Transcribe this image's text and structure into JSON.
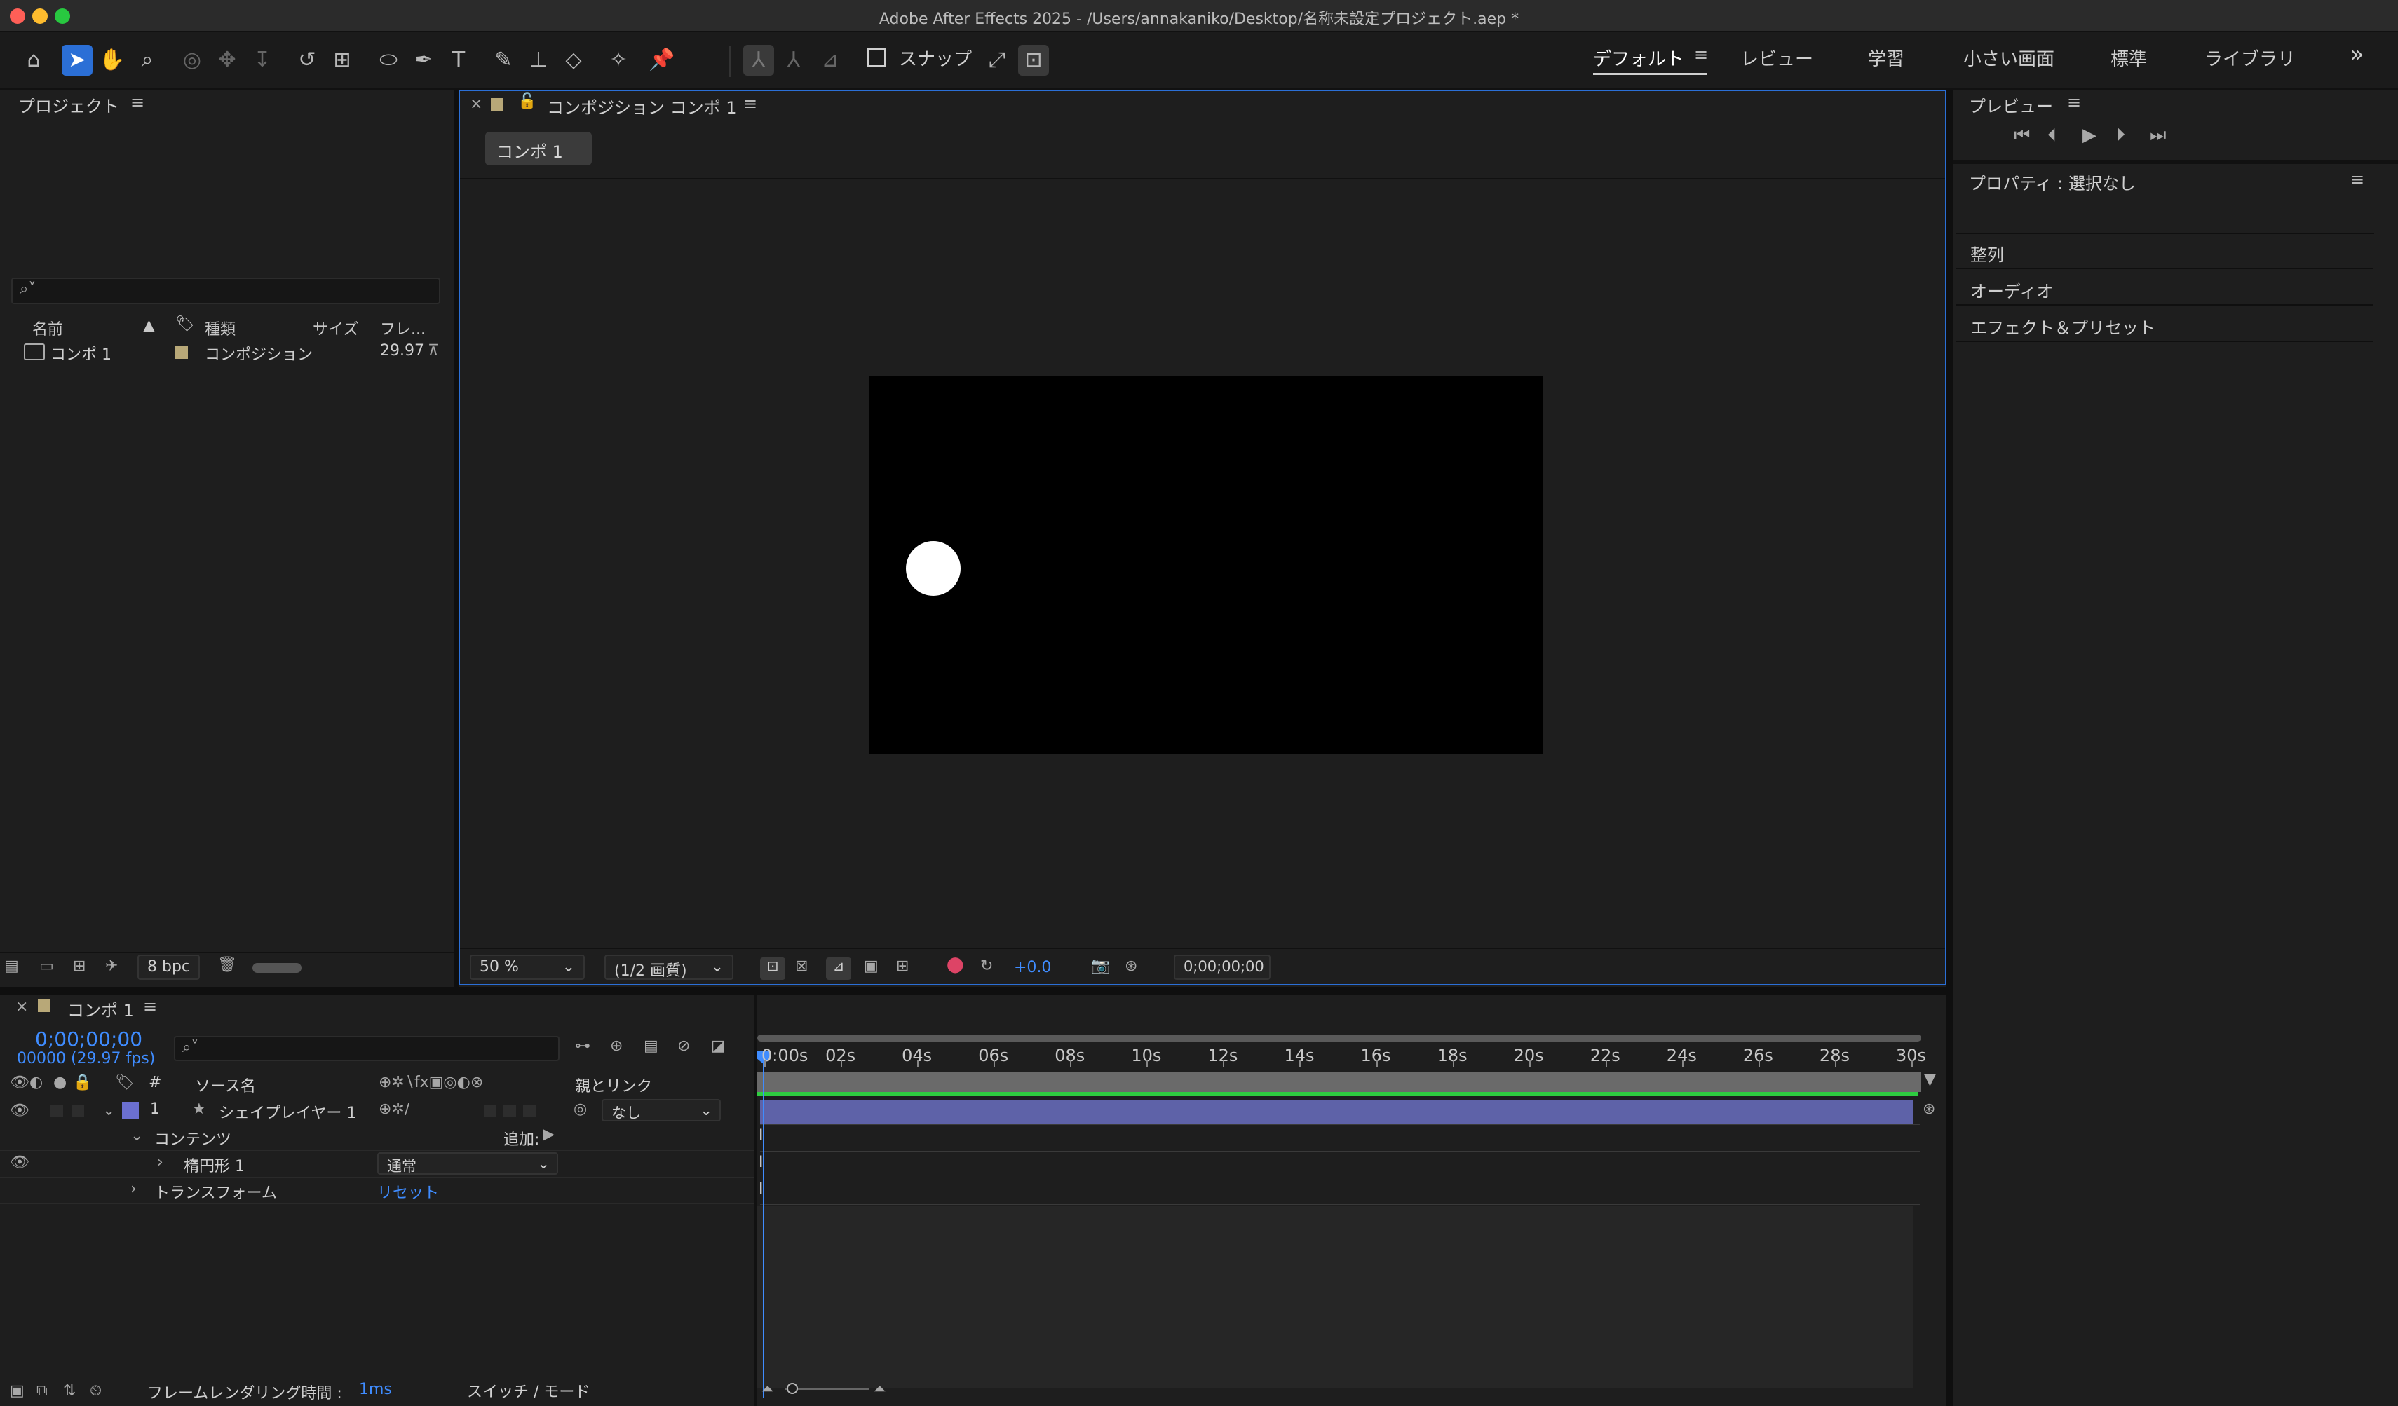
{
  "window": {
    "title": "Adobe After Effects 2025 - /Users/annakaniko/Desktop/名称未設定プロジェクト.aep *"
  },
  "colors": {
    "accent": "#2b6fd6",
    "timecode": "#3f8cff",
    "layer_bar": "#5e62a8",
    "work_area": "#2ecc40",
    "label_tan": "#b8a878"
  },
  "toolbar": {
    "icons": [
      "home-icon",
      "selection-tool-icon",
      "hand-tool-icon",
      "zoom-tool-icon",
      "orbit-camera-icon",
      "pan-camera-icon",
      "dolly-camera-icon",
      "rotation-tool-icon",
      "pan-behind-icon",
      "ellipse-tool-icon",
      "pen-tool-icon",
      "type-tool-icon",
      "brush-tool-icon",
      "clone-stamp-icon",
      "eraser-icon",
      "roto-brush-icon",
      "puppet-pin-icon"
    ],
    "snap_label": "スナップ"
  },
  "workspaces": {
    "items": [
      "デフォルト",
      "レビュー",
      "学習",
      "小さい画面",
      "標準",
      "ライブラリ"
    ],
    "active": "デフォルト",
    "more": "»"
  },
  "project_panel": {
    "title": "プロジェクト",
    "search_placeholder": "",
    "columns": {
      "name": "名前",
      "type": "種類",
      "size": "サイズ",
      "frame": "フレ..."
    },
    "items": [
      {
        "name": "コンポ 1",
        "type": "コンポジション",
        "frame": "29.97"
      }
    ],
    "bpc": "8 bpc"
  },
  "composition_panel": {
    "title": "コンポジション コンポ 1",
    "comp_tab": "コンポ 1",
    "zoom": "50 %",
    "quality": "(1/2 画質)",
    "exposure": "+0.0",
    "timecode": "0;00;00;00"
  },
  "preview_panel": {
    "title": "プレビュー"
  },
  "properties_panel": {
    "title": "プロパティ : 選択なし",
    "items": [
      "整列",
      "オーディオ",
      "エフェクト＆プリセット"
    ]
  },
  "timeline": {
    "tab": "コンポ 1",
    "timecode": "0;00;00;00",
    "frame_info": "00000 (29.97 fps)",
    "columns": {
      "hash": "#",
      "source": "ソース名",
      "parent": "親とリンク"
    },
    "ticks": [
      "0:00s",
      "02s",
      "04s",
      "06s",
      "08s",
      "10s",
      "12s",
      "14s",
      "16s",
      "18s",
      "20s",
      "22s",
      "24s",
      "26s",
      "28s",
      "30s"
    ],
    "layer": {
      "index": "1",
      "name": "シェイプレイヤー 1",
      "parent": "なし"
    },
    "contents_label": "コンテンツ",
    "add_label": "追加:",
    "ellipse_label": "楕円形 1",
    "blend_mode": "通常",
    "transform_label": "トランスフォーム",
    "reset_label": "リセット",
    "render_label": "フレームレンダリング時間 :",
    "render_value": "1ms",
    "switch_mode": "スイッチ / モード"
  }
}
